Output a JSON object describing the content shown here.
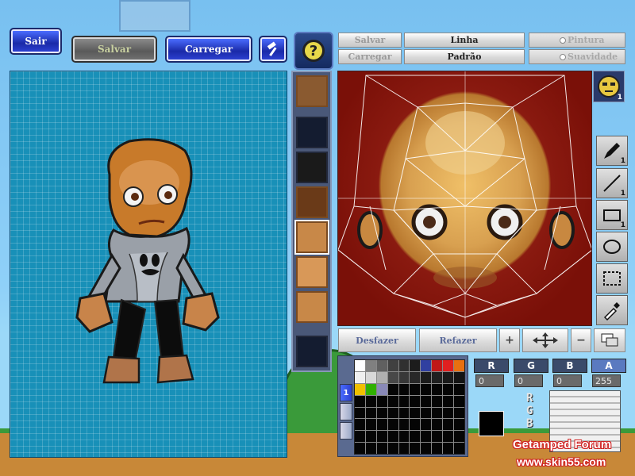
{
  "top_buttons": {
    "sair": "Sair",
    "salvar": "Salvar",
    "carregar": "Carregar"
  },
  "tool_row": {
    "salvar": "Salvar",
    "carregar": "Carregar",
    "linha": "Linha",
    "padrao": "Padrão",
    "pintura": "Pintura",
    "suavidade": "Suavidade"
  },
  "tools": {
    "pen_count": "1",
    "line_count": "1",
    "rect_count": "1",
    "face_count": "1"
  },
  "edit": {
    "desfazer": "Desfazer",
    "refazer": "Refazer"
  },
  "color": {
    "r_label": "R",
    "g_label": "G",
    "b_label": "B",
    "a_label": "A",
    "r_value": "0",
    "g_value": "0",
    "b_value": "0",
    "a_value": "255",
    "current_hex": "#000000"
  },
  "palette_tabs": [
    "1"
  ],
  "palette_colors": [
    "#ffffff",
    "#808080",
    "#606060",
    "#404040",
    "#303030",
    "#1c1c1c",
    "#3040a0",
    "#c01818",
    "#e02020",
    "#e87010",
    "#f0f0f0",
    "#d8d8d8",
    "#b0b0b0",
    "#484848",
    "#383838",
    "#282828",
    "#1c1c1c",
    "#202020",
    "#1a1a1a",
    "#141414",
    "#f0c000",
    "#30b000",
    "#8a8ab8",
    "#050505",
    "#050505",
    "#050505",
    "#050505",
    "#050505",
    "#050505",
    "#050505"
  ],
  "watermark": {
    "line1": "Getamped Forum",
    "line2": "www.skin55.com"
  },
  "icons": [
    "hammer-icon",
    "help-icon",
    "pen-icon",
    "line-icon",
    "rect-icon",
    "ellipse-icon",
    "select-icon",
    "eyedropper-icon",
    "move-icon"
  ]
}
